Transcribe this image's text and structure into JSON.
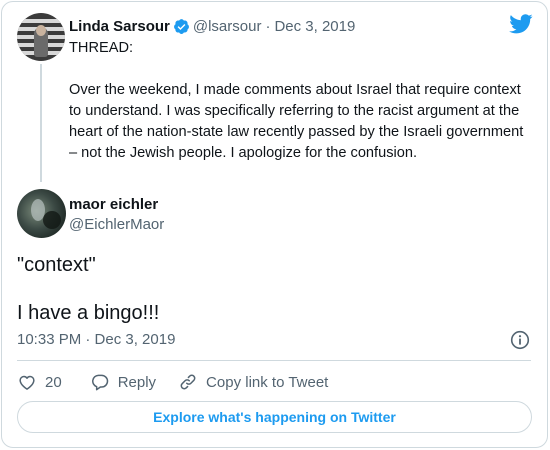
{
  "parent_tweet": {
    "author_name": "Linda Sarsour",
    "handle": "@lsarsour",
    "separator": "·",
    "date": "Dec 3, 2019",
    "text": "THREAD:\n\nOver the weekend, I made comments about Israel that require context to understand. I was specifically referring to the racist argument at the heart of the nation-state law recently passed by the Israeli government – not the Jewish people. I apologize for the confusion."
  },
  "tweet": {
    "author_name": "maor eichler",
    "handle": "@EichlerMaor",
    "text": "\"context\"\n\nI have a bingo!!!",
    "timestamp": "10:33 PM · Dec 3, 2019"
  },
  "actions": {
    "like_count": "20",
    "reply_label": "Reply",
    "copy_link_label": "Copy link to Tweet"
  },
  "explore_label": "Explore what's happening on Twitter",
  "icons": {
    "verified": "verified-badge-icon",
    "brand": "twitter-bird-icon",
    "info": "info-icon",
    "like": "heart-icon",
    "reply": "speech-bubble-icon",
    "copy_link": "link-icon"
  },
  "colors": {
    "accent": "#1d9bf0",
    "secondary_text": "#536471",
    "border": "#cfd9de"
  }
}
